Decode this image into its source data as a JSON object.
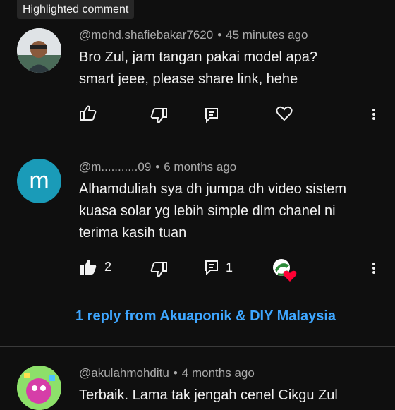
{
  "highlight_label": "Highlighted comment",
  "comments": [
    {
      "author": "@mohd.shafiebakar7620",
      "time": "45 minutes ago",
      "text_lines": [
        "Bro Zul, jam tangan  pakai model apa?",
        "smart jeee, please share link, hehe"
      ],
      "like_count": "",
      "reply_count": ""
    },
    {
      "author": "@m...........09",
      "time": "6 months ago",
      "avatar_letter": "m",
      "avatar_color": "#1a9bb8",
      "text_lines": [
        "Alhamduliah sya dh jumpa dh video sistem",
        "kuasa solar yg lebih simple dlm chanel ni",
        "terima kasih tuan"
      ],
      "like_count": "2",
      "reply_count": "1",
      "replies_link": "1 reply from Akuaponik & DIY Malaysia"
    },
    {
      "author": "@akulahmohditu",
      "time": "4 months ago",
      "text_lines": [
        "Terbaik. Lama tak jengah cenel Cikgu Zul"
      ]
    }
  ],
  "icons": {
    "like": "thumbs-up-icon",
    "dislike": "thumbs-down-icon",
    "reply": "reply-icon",
    "heart": "heart-icon",
    "more": "more-vertical-icon"
  },
  "colors": {
    "link": "#3ea6ff",
    "heart": "#ff0033"
  }
}
